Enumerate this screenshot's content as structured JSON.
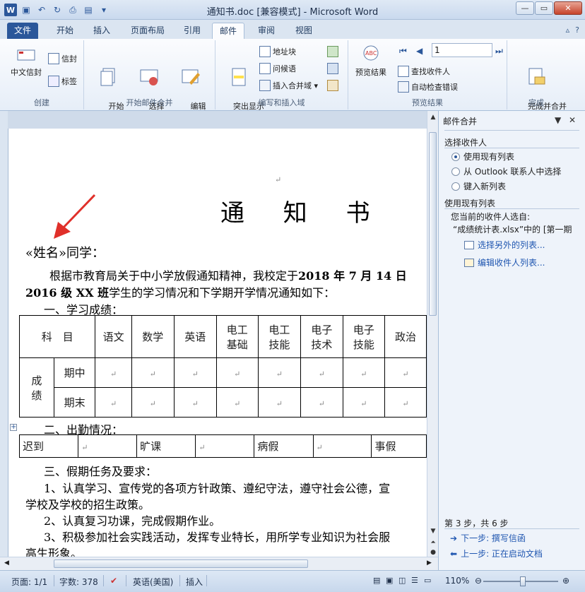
{
  "window": {
    "title": "通知书.doc [兼容模式] - Microsoft Word"
  },
  "tabs": [
    "文件",
    "开始",
    "插入",
    "页面布局",
    "引用",
    "邮件",
    "审阅",
    "视图"
  ],
  "ribbon": {
    "create": {
      "label": "创建",
      "chinese_envelope": "中文信封",
      "envelopes": "信封",
      "labels": "标签"
    },
    "start_merge": {
      "label": "开始邮件合并",
      "start": "开始\n邮件合并 ▾",
      "select": "选择\n收件人 ▾",
      "edit": "编辑\n收件人列表"
    },
    "write_insert": {
      "label": "编写和插入域",
      "highlight": "突出显示\n合并域",
      "address_block": "地址块",
      "greeting_line": "问候语",
      "insert_field": "插入合并域 ▾"
    },
    "preview": {
      "label": "预览结果",
      "preview_btn": "预览结果",
      "record": "1",
      "find": "查找收件人",
      "check": "自动检查错误"
    },
    "finish": {
      "label": "完成",
      "finish_btn": "完成并合并\n▾"
    }
  },
  "document": {
    "title": "通 知 书",
    "salutation": "«姓名»同学：",
    "para1_a": "根据市教育局关于中小学放假通知精神，我校定于",
    "para1_b": "2018 年 7 月 14 日",
    "para2_a": "2016 级 XX 班",
    "para2_b": "学生的学习情况和下学期开学情况通知如下：",
    "sec1": "一、学习成绩：",
    "grades_table": {
      "subject_header": "科　目",
      "subjects": [
        "语文",
        "数学",
        "英语",
        "电工\n基础",
        "电工\n技能",
        "电子\n技术",
        "电子\n技能",
        "政治"
      ],
      "row_group": "成\n绩",
      "rows": [
        "期中",
        "期末"
      ]
    },
    "sec2": "二、出勤情况：",
    "attend_labels": [
      "迟到",
      "旷课",
      "病假",
      "事假"
    ],
    "sec3": "三、假期任务及要求：",
    "item1_a": "1、认真学习、宣传党的各项方针政策、遵纪守法，遵守社会公德，宣",
    "item1_b": "学校及学校的招生政策。",
    "item2": "2、认真复习功课，完成假期作业。",
    "item3_a": "3、积极参加社会实践活动，发挥专业特长，用所学专业知识为社会服",
    "item3_b": "高生形象。",
    "cell_mark": "↵"
  },
  "pane": {
    "title": "邮件合并",
    "select_recipients": "选择收件人",
    "options": [
      "使用现有列表",
      "从 Outlook 联系人中选择",
      "键入新列表"
    ],
    "use_existing": "使用现有列表",
    "current_from": "您当前的收件人选自:",
    "source": "“成绩统计表.xlsx”中的 [第一期",
    "link_other": "选择另外的列表...",
    "link_edit": "编辑收件人列表...",
    "step": "第 3 步，共 6 步",
    "next": "下一步: 撰写信函",
    "prev": "上一步: 正在启动文档"
  },
  "status": {
    "page": "页面: 1/1",
    "words": "字数: 378",
    "lang": "英语(美国)",
    "mode": "插入",
    "zoom": "110%"
  }
}
